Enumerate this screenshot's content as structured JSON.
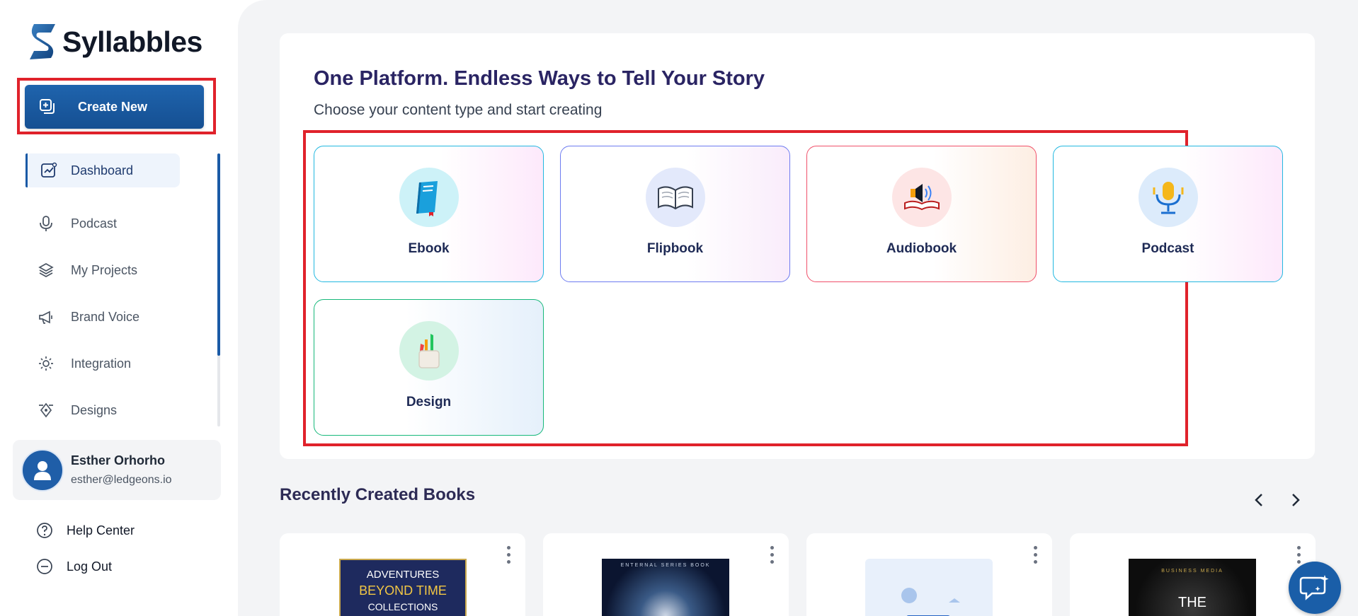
{
  "app": {
    "name": "Syllabbles"
  },
  "sidebar": {
    "create_label": "Create New",
    "nav": [
      {
        "label": "Dashboard",
        "icon": "chart-icon",
        "active": true
      },
      {
        "label": "Podcast",
        "icon": "microphone-icon"
      },
      {
        "label": "My Projects",
        "icon": "layers-icon"
      },
      {
        "label": "Brand Voice",
        "icon": "megaphone-icon"
      },
      {
        "label": "Integration",
        "icon": "gear-integration-icon"
      },
      {
        "label": "Designs",
        "icon": "pen-tool-icon"
      }
    ],
    "user": {
      "name": "Esther Orhorho",
      "email": "esther@ledgeons.io"
    },
    "help_label": "Help Center",
    "logout_label": "Log Out"
  },
  "main": {
    "title": "One Platform. Endless Ways to Tell Your Story",
    "subtitle": "Choose your content type and start creating",
    "content_types": [
      {
        "label": "Ebook",
        "icon": "blue-book-icon"
      },
      {
        "label": "Flipbook",
        "icon": "open-book-icon"
      },
      {
        "label": "Audiobook",
        "icon": "speaker-book-icon"
      },
      {
        "label": "Podcast",
        "icon": "podcast-mic-icon"
      },
      {
        "label": "Design",
        "icon": "pencil-cup-icon"
      }
    ],
    "recent_title": "Recently Created Books",
    "books": [
      {
        "cover_line1": "ADVENTURES",
        "cover_line2": "BEYOND TIME",
        "cover_line3": "COLLECTIONS"
      },
      {
        "cover_line1": "ENTERNAL SERIES BOOK"
      },
      {
        "cover_line1": ""
      },
      {
        "cover_line1": "BUSINESS MEDIA",
        "cover_line2": "THE"
      }
    ]
  },
  "colors": {
    "brand": "#1a5aa6",
    "highlight": "#e0222b",
    "title": "#2a2463"
  }
}
